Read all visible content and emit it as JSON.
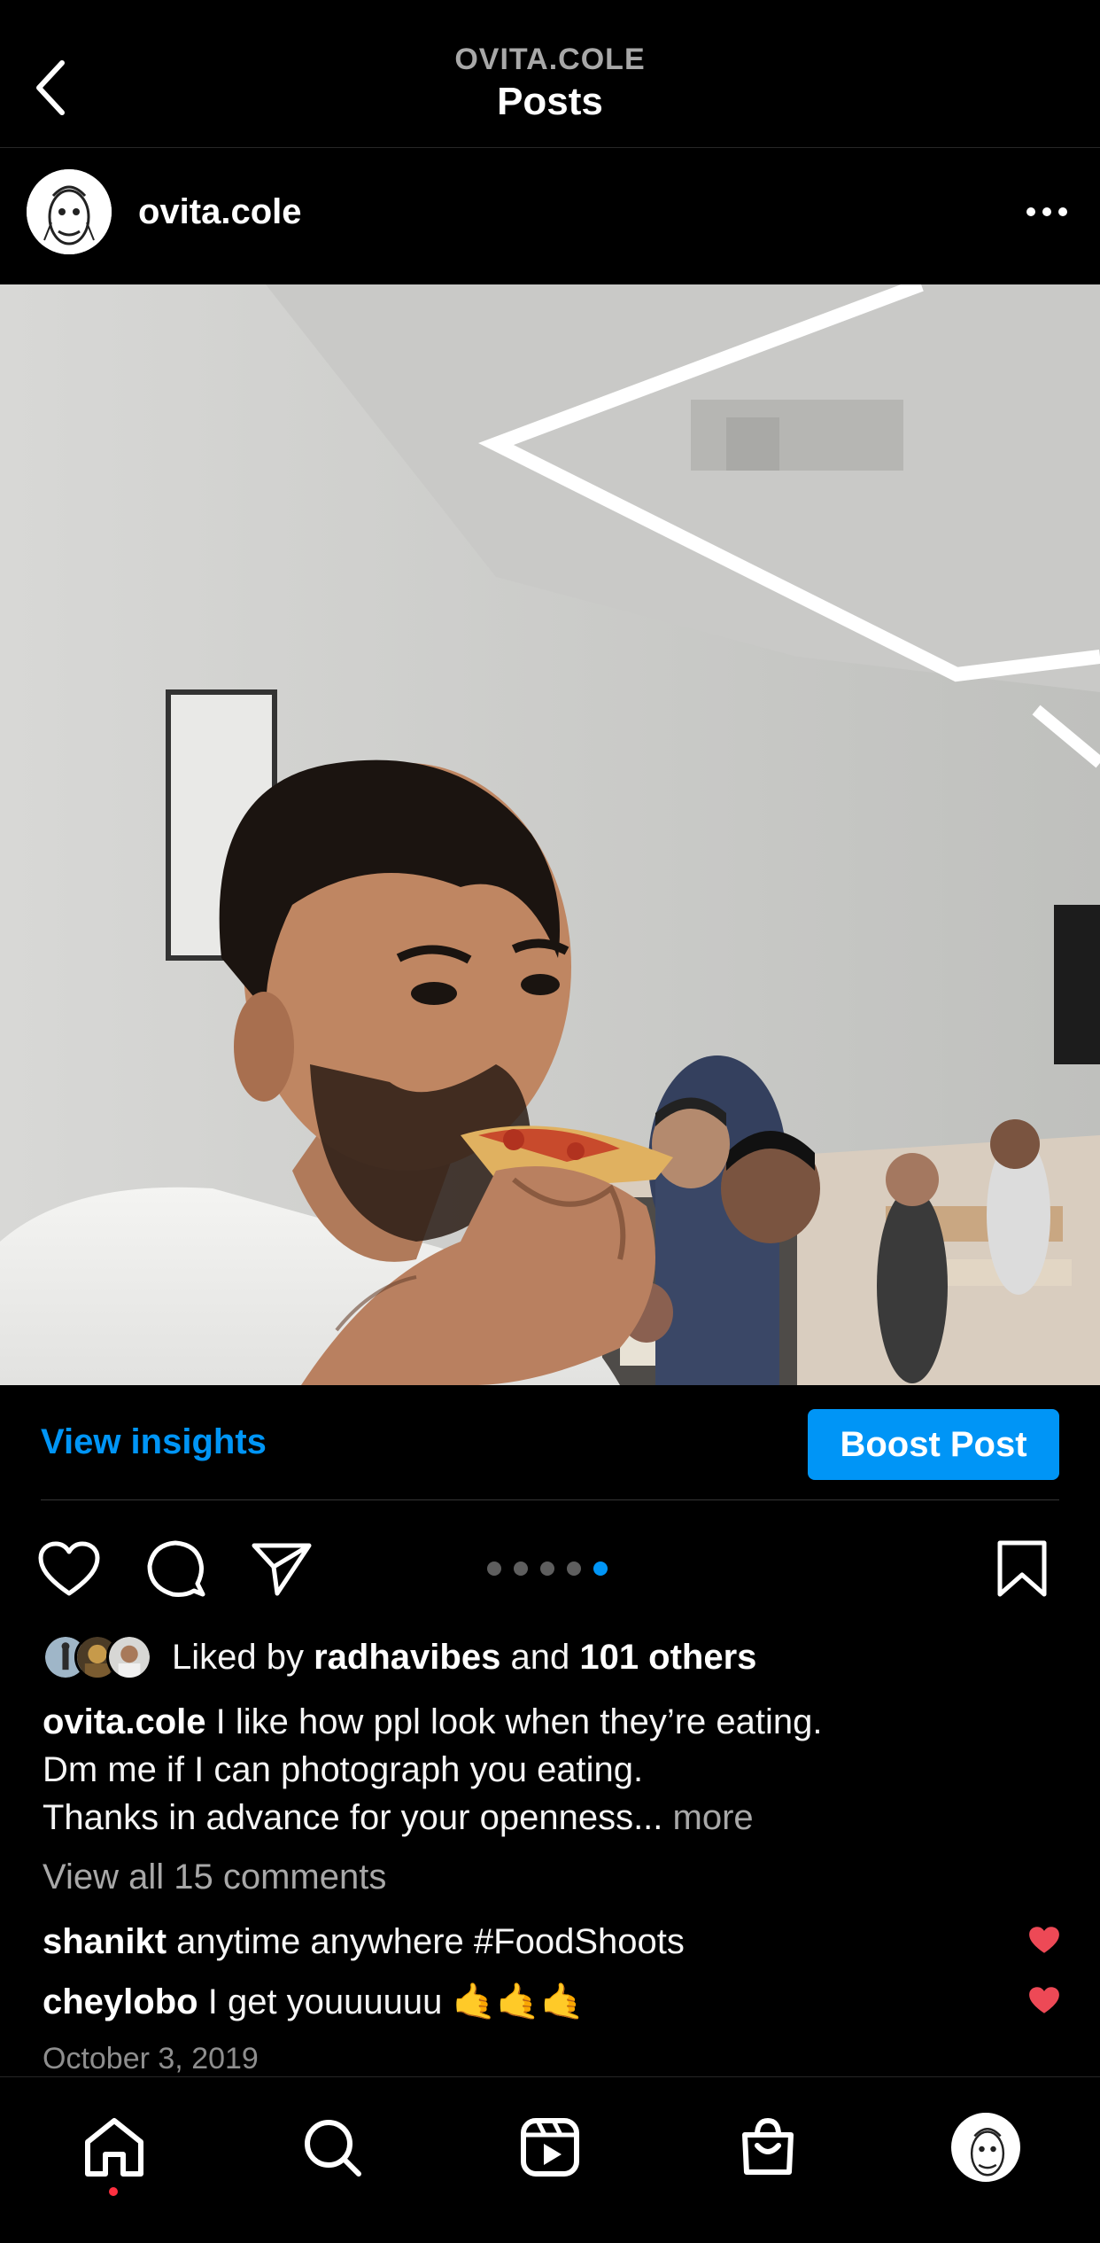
{
  "header": {
    "subtitle": "OVITA.COLE",
    "title": "Posts"
  },
  "post": {
    "username": "ovita.cole",
    "carousel": {
      "count": 5,
      "active_index": 4
    },
    "insights_label": "View insights",
    "boost_label": "Boost Post",
    "likes": {
      "prefix": "Liked by",
      "first_liker": "radhavibes",
      "joiner": "and",
      "others": "101 others"
    },
    "caption": {
      "author": "ovita.cole",
      "line1": "I like how ppl look when they’re eating.",
      "line2": "Dm me if I can photograph you eating.",
      "line3": "Thanks in advance for your openness...",
      "more": "more"
    },
    "view_all_comments": "View all 15 comments",
    "comments": [
      {
        "user": "shanikt",
        "text": "anytime anywhere #FoodShoots",
        "liked": true
      },
      {
        "user": "cheylobo",
        "text": "I get youuuuuu 🤙🤙🤙",
        "liked": true
      }
    ],
    "date": "October 3, 2019"
  },
  "colors": {
    "accent": "#0095f6",
    "heart_red": "#ed4956",
    "muted": "#a8a8a8"
  },
  "nav": {
    "items": [
      "home-icon",
      "search-icon",
      "reels-icon",
      "shop-icon",
      "profile-avatar"
    ],
    "active": "home-icon"
  }
}
